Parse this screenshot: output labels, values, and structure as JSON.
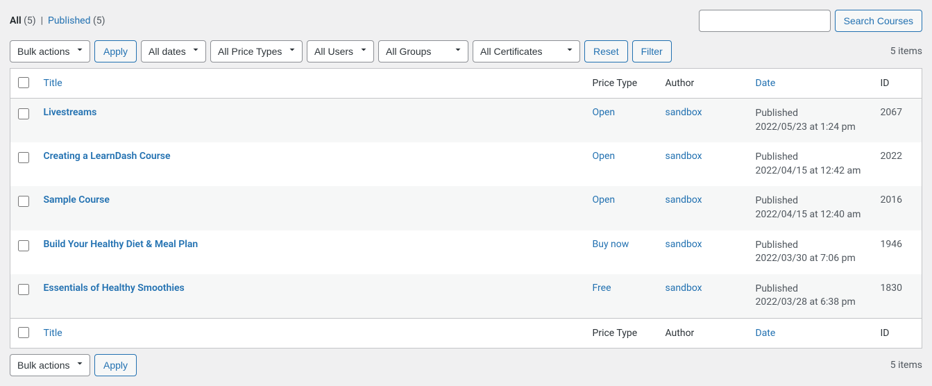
{
  "filter_links": {
    "all_label": "All",
    "all_count": "(5)",
    "separator": "|",
    "published_label": "Published",
    "published_count": "(5)"
  },
  "search": {
    "button": "Search Courses"
  },
  "bulk_actions": {
    "label": "Bulk actions",
    "apply": "Apply"
  },
  "filters": {
    "dates": "All dates",
    "price_types": "All Price Types",
    "users": "All Users",
    "groups": "All Groups",
    "certificates": "All Certificates",
    "reset": "Reset",
    "filter": "Filter"
  },
  "pagination": {
    "items_label": "5 items"
  },
  "columns": {
    "title": "Title",
    "price_type": "Price Type",
    "author": "Author",
    "date": "Date",
    "id": "ID"
  },
  "rows": [
    {
      "title": "Livestreams",
      "price_type": "Open",
      "author": "sandbox",
      "status": "Published",
      "date": "2022/05/23 at 1:24 pm",
      "id": "2067"
    },
    {
      "title": "Creating a LearnDash Course",
      "price_type": "Open",
      "author": "sandbox",
      "status": "Published",
      "date": "2022/04/15 at 12:42 am",
      "id": "2022"
    },
    {
      "title": "Sample Course",
      "price_type": "Open",
      "author": "sandbox",
      "status": "Published",
      "date": "2022/04/15 at 12:40 am",
      "id": "2016"
    },
    {
      "title": "Build Your Healthy Diet & Meal Plan",
      "price_type": "Buy now",
      "author": "sandbox",
      "status": "Published",
      "date": "2022/03/30 at 7:06 pm",
      "id": "1946"
    },
    {
      "title": "Essentials of Healthy Smoothies",
      "price_type": "Free",
      "author": "sandbox",
      "status": "Published",
      "date": "2022/03/28 at 6:38 pm",
      "id": "1830"
    }
  ]
}
